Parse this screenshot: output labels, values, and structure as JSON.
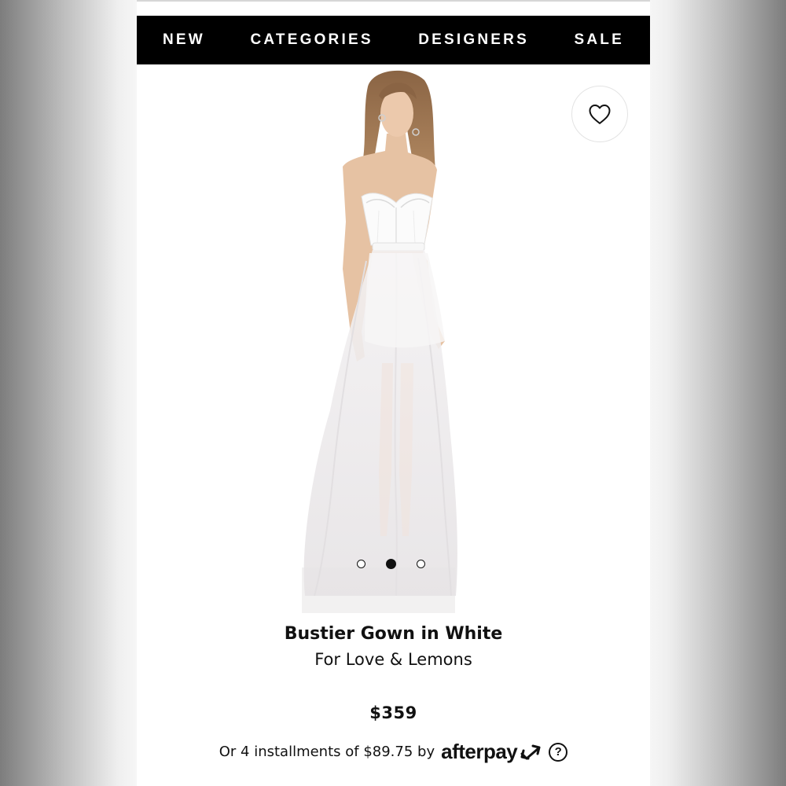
{
  "nav": {
    "items": [
      {
        "label": "NEW"
      },
      {
        "label": "CATEGORIES"
      },
      {
        "label": "DESIGNERS"
      },
      {
        "label": "SALE"
      }
    ]
  },
  "gallery": {
    "image_count": 3,
    "active_index": 1,
    "favorite_icon": "heart-outline-icon"
  },
  "product": {
    "name": "Bustier Gown in White",
    "designer": "For Love & Lemons",
    "price": "$359"
  },
  "payment": {
    "installments_text": "Or 4 installments of $89.75 by",
    "provider": "afterpay",
    "provider_icon": "afterpay-arrows-icon",
    "help_label": "?"
  },
  "colors": {
    "nav_background": "#000000",
    "nav_text": "#ffffff",
    "text": "#111111",
    "page_background": "#ffffff"
  }
}
